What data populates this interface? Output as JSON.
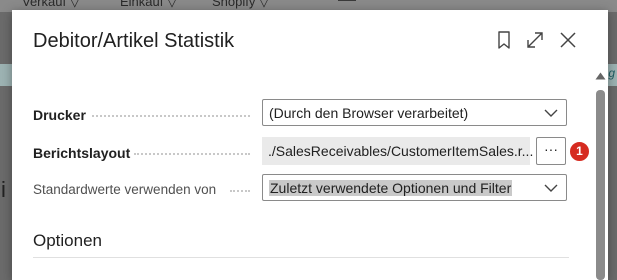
{
  "background": {
    "nav_items": [
      "Verkauf ▽",
      "Einkauf ▽",
      "Shopify ▽"
    ],
    "right_fragment": "ng",
    "left_fragment": "i"
  },
  "dialog": {
    "title": "Debitor/Artikel Statistik",
    "header_icons": [
      "bookmark-icon",
      "expand-icon",
      "close-icon"
    ],
    "fields": {
      "printer": {
        "label": "Drucker",
        "value": "(Durch den Browser verarbeitet)"
      },
      "report_layout": {
        "label": "Berichtslayout",
        "value": "./SalesReceivables/CustomerItemSales.r...",
        "assist_label": "···",
        "badge": "1"
      },
      "defaults": {
        "label": "Standardwerte verwenden von",
        "value": "Zuletzt verwendete Optionen und Filter"
      }
    },
    "section": {
      "title": "Optionen"
    }
  },
  "colors": {
    "badge": "#d62b20",
    "highlight": "#c9c9c9",
    "scroll_thumb": "#8b8b8b"
  }
}
